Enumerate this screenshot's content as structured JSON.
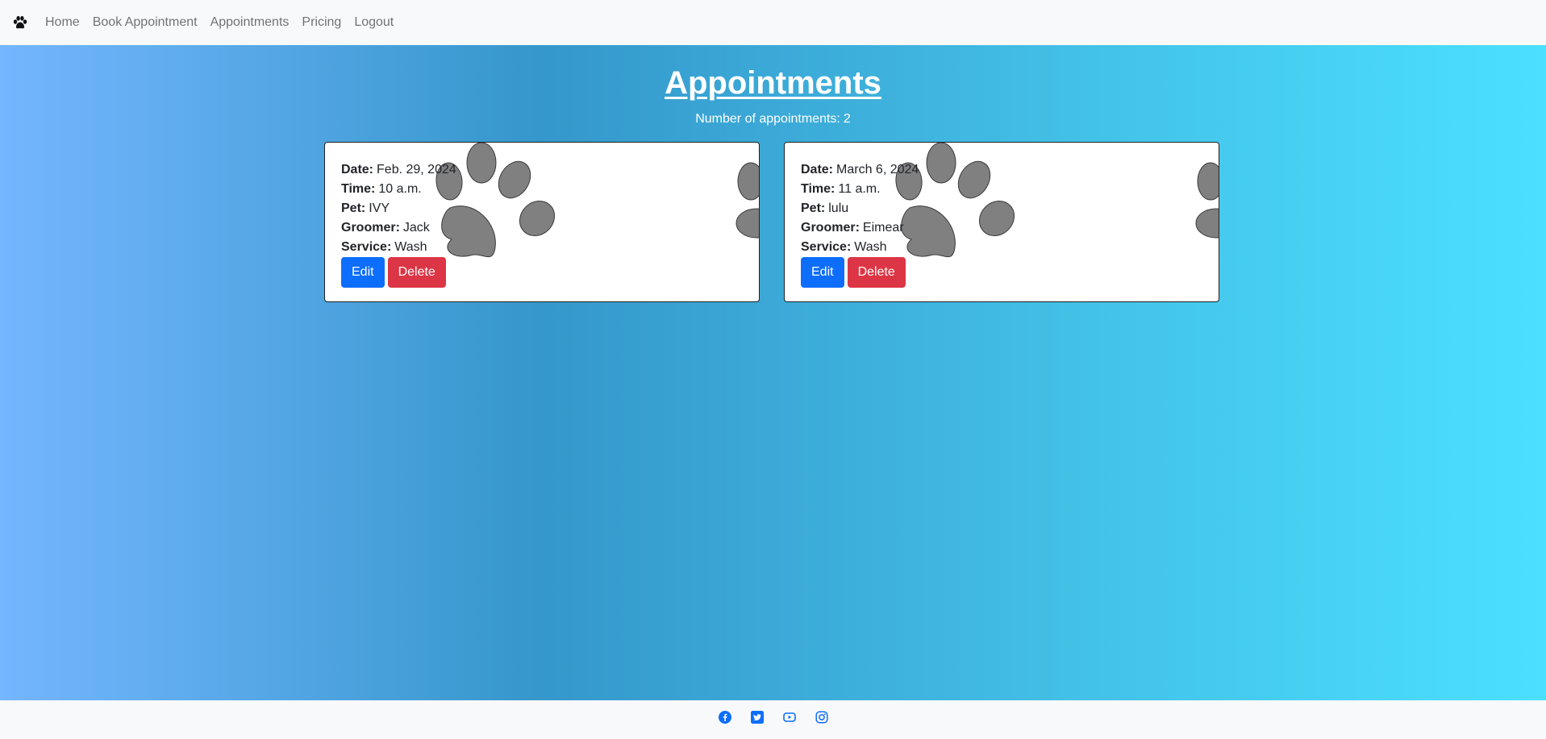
{
  "nav": {
    "brand_icon": "paw-icon",
    "links": [
      "Home",
      "Book Appointment",
      "Appointments",
      "Pricing",
      "Logout"
    ]
  },
  "page": {
    "title": "Appointments",
    "count_label": "Number of appointments:",
    "count_value": "2"
  },
  "labels": {
    "date": "Date:",
    "time": "Time:",
    "pet": "Pet:",
    "groomer": "Groomer:",
    "service": "Service:"
  },
  "appointments": [
    {
      "date": "Feb. 29, 2024",
      "time": "10 a.m.",
      "pet": "IVY",
      "groomer": "Jack",
      "service": "Wash",
      "edit_label": "Edit",
      "delete_label": "Delete"
    },
    {
      "date": "March 6, 2024",
      "time": "11 a.m.",
      "pet": "lulu",
      "groomer": "Eimear",
      "service": "Wash",
      "edit_label": "Edit",
      "delete_label": "Delete"
    }
  ],
  "footer": {
    "icons": [
      "facebook-icon",
      "twitter-icon",
      "youtube-icon",
      "instagram-icon"
    ]
  },
  "colors": {
    "edit": "#0d6efd",
    "delete": "#dc3545",
    "paw_fill": "#808080",
    "social": "#0d6efd"
  }
}
